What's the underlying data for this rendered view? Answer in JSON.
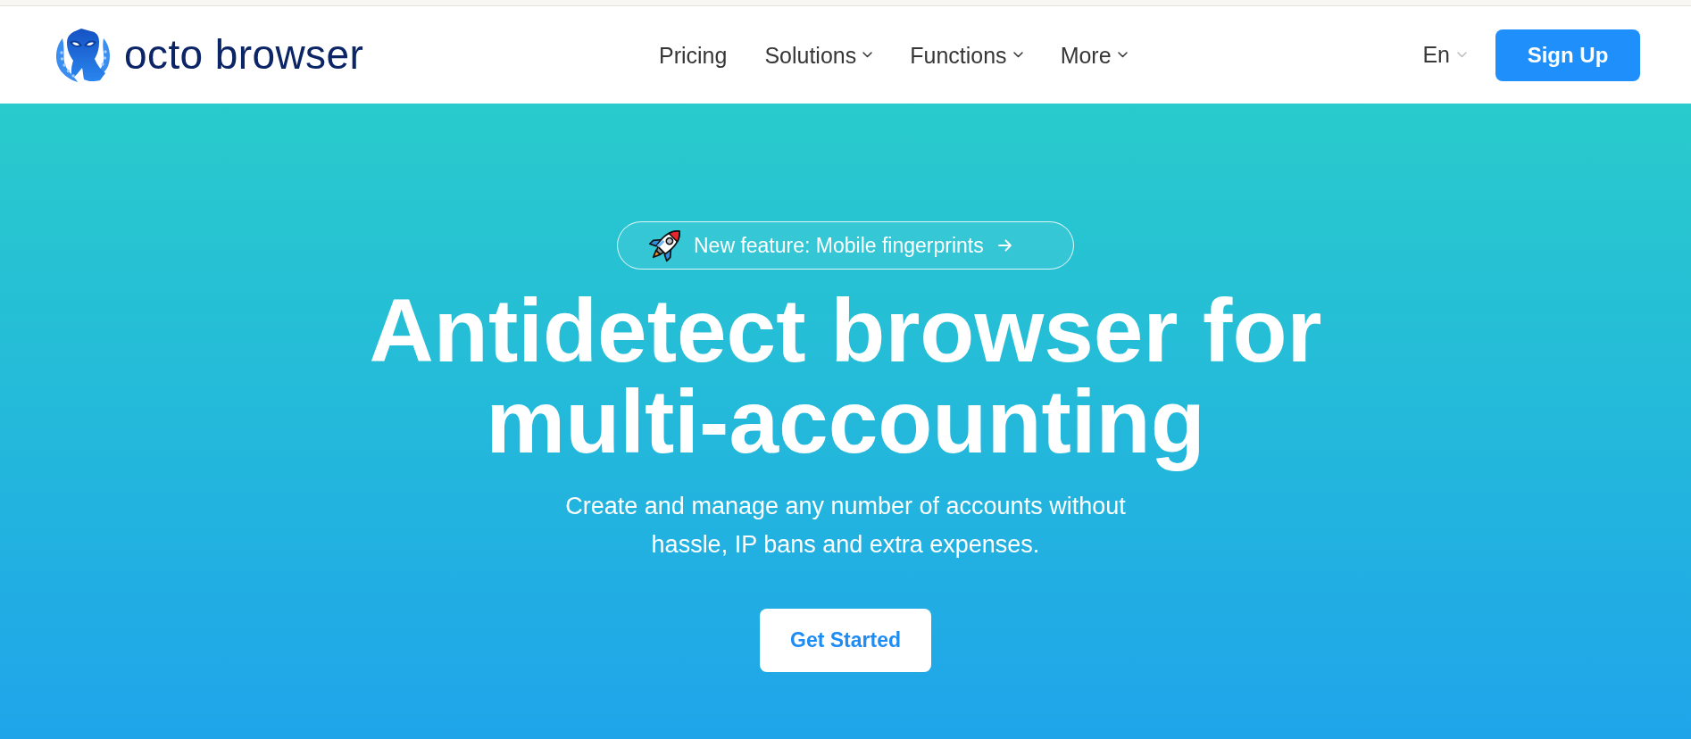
{
  "header": {
    "logo": {
      "text": "octo browser"
    },
    "nav": [
      {
        "label": "Pricing",
        "dropdown": false
      },
      {
        "label": "Solutions",
        "dropdown": true
      },
      {
        "label": "Functions",
        "dropdown": true
      },
      {
        "label": "More",
        "dropdown": true
      }
    ],
    "language": {
      "label": "En"
    },
    "signup_button": {
      "label": "Sign Up"
    }
  },
  "hero": {
    "announcement": {
      "text": "New feature: Mobile fingerprints"
    },
    "title": "Antidetect browser for multi-accounting",
    "subtitle": "Create and manage any number of accounts without hassle, IP bans and extra expenses.",
    "cta_button": {
      "label": "Get Started"
    }
  }
}
